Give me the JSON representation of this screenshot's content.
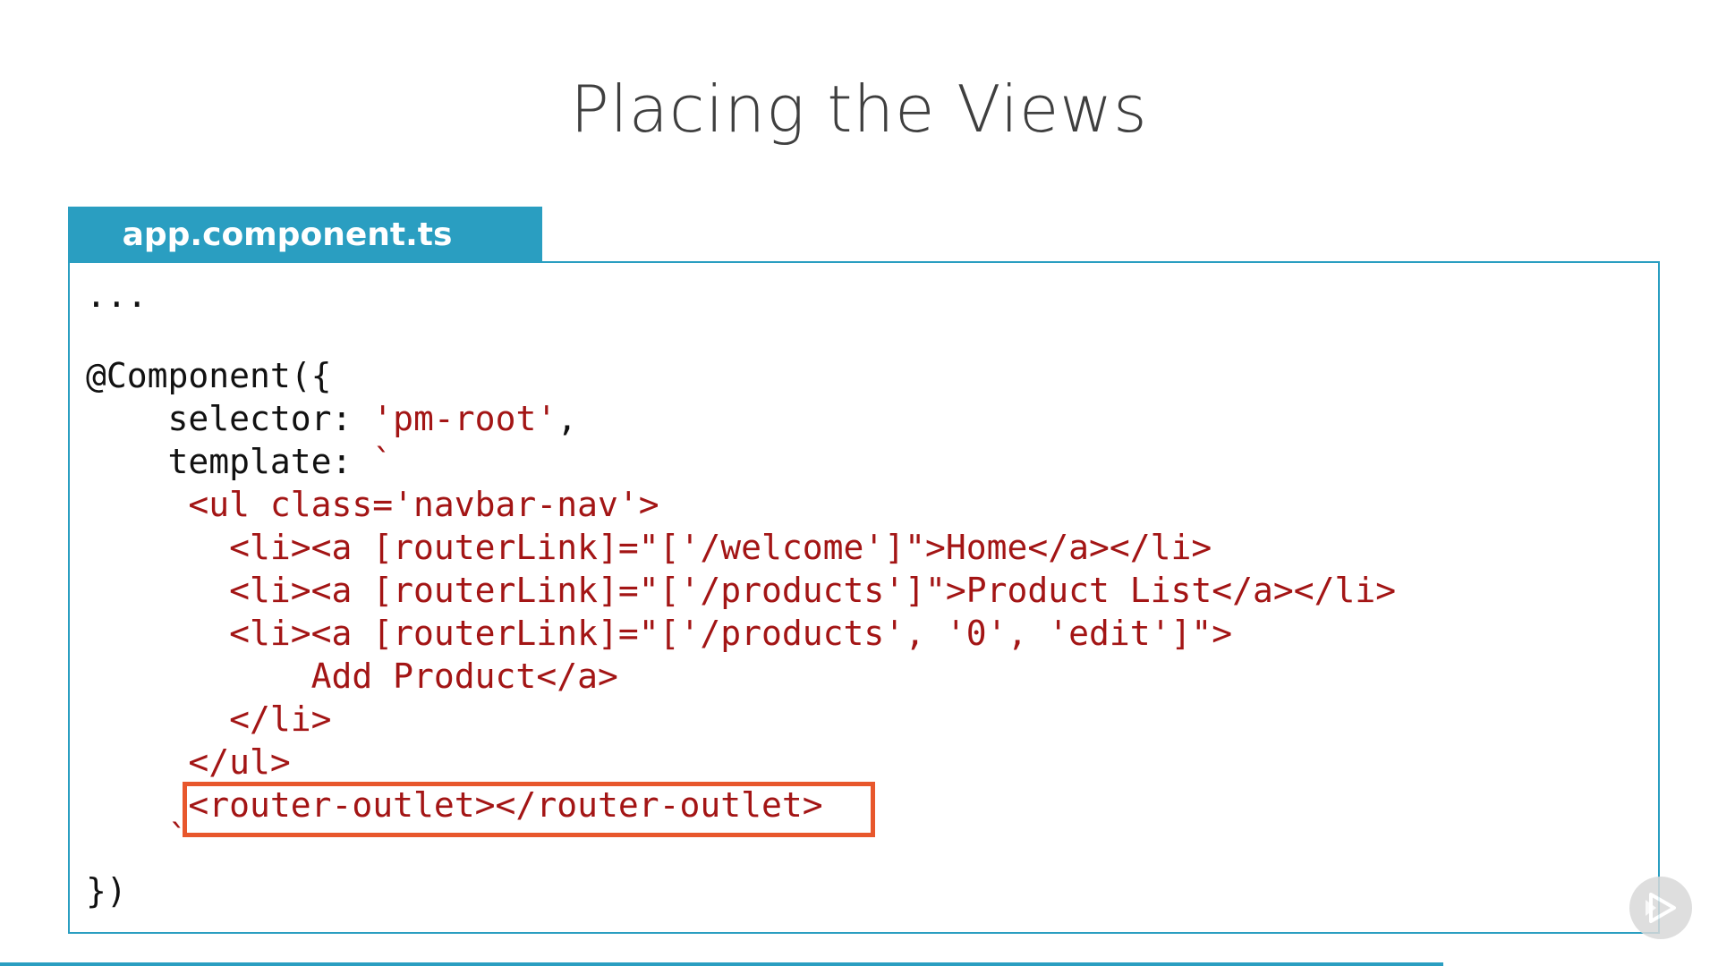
{
  "slide": {
    "title": "Placing the Views"
  },
  "file_tab": {
    "label": "app.component.ts"
  },
  "code": {
    "l01": "...",
    "l02": "@Component({",
    "l03a": "    selector: ",
    "l03b": "'pm-root'",
    "l03c": ",",
    "l04a": "    template: ",
    "l04b": "`",
    "l05": "     <ul class='navbar-nav'>",
    "l06": "       <li><a [routerLink]=\"['/welcome']\">Home</a></li>",
    "l07": "       <li><a [routerLink]=\"['/products']\">Product List</a></li>",
    "l08": "       <li><a [routerLink]=\"['/products', '0', 'edit']\">",
    "l09": "           Add Product</a>",
    "l10": "       </li>",
    "l11": "     </ul>",
    "l12": "     <router-outlet></router-outlet>",
    "l13": "    `",
    "l14": "})"
  },
  "colors": {
    "accent": "#2a9ec1",
    "highlight": "#e8572c",
    "string": "#a31515",
    "progress": "#2a9ec1"
  },
  "player": {
    "icon": "play-forward-icon",
    "progress": 0.84
  }
}
